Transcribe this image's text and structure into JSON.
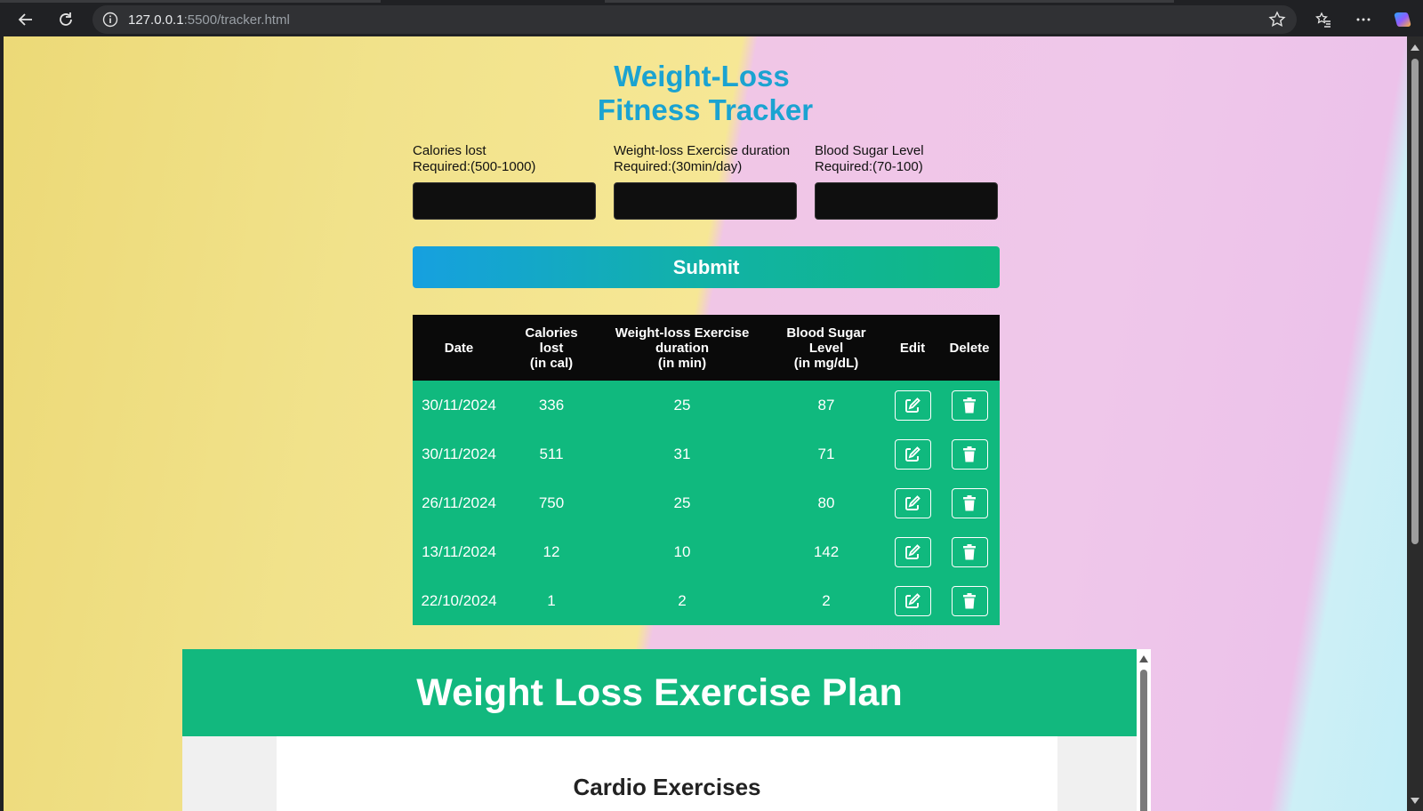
{
  "browser": {
    "url_host": "127.0.0.1",
    "url_rest": ":5500/tracker.html"
  },
  "page": {
    "title_line1": "Weight-Loss",
    "title_line2": "Fitness Tracker",
    "fields": [
      {
        "label_line1": "Calories lost",
        "label_line2": "Required:(500-1000)",
        "value": ""
      },
      {
        "label_line1": "Weight-loss Exercise duration",
        "label_line2": "Required:(30min/day)",
        "value": ""
      },
      {
        "label_line1": "Blood Sugar Level",
        "label_line2": "Required:(70-100)",
        "value": ""
      }
    ],
    "submit_label": "Submit",
    "table": {
      "headers": [
        "Date",
        "Calories\nlost\n(in cal)",
        "Weight-loss Exercise\nduration\n(in min)",
        "Blood Sugar\nLevel\n(in mg/dL)",
        "Edit",
        "Delete"
      ],
      "rows": [
        {
          "date": "30/11/2024",
          "calories": "336",
          "duration": "25",
          "sugar": "87"
        },
        {
          "date": "30/11/2024",
          "calories": "511",
          "duration": "31",
          "sugar": "71"
        },
        {
          "date": "26/11/2024",
          "calories": "750",
          "duration": "25",
          "sugar": "80"
        },
        {
          "date": "13/11/2024",
          "calories": "12",
          "duration": "10",
          "sugar": "142"
        },
        {
          "date": "22/10/2024",
          "calories": "1",
          "duration": "2",
          "sugar": "2"
        }
      ]
    }
  },
  "plan": {
    "heading": "Weight Loss Exercise Plan",
    "section_title": "Cardio Exercises"
  },
  "colors": {
    "title": "#1ba3d1",
    "accent_green": "#10b981",
    "header_black": "#0a0a0a"
  },
  "icons": {
    "edit": "edit-icon",
    "delete": "trash-icon"
  }
}
